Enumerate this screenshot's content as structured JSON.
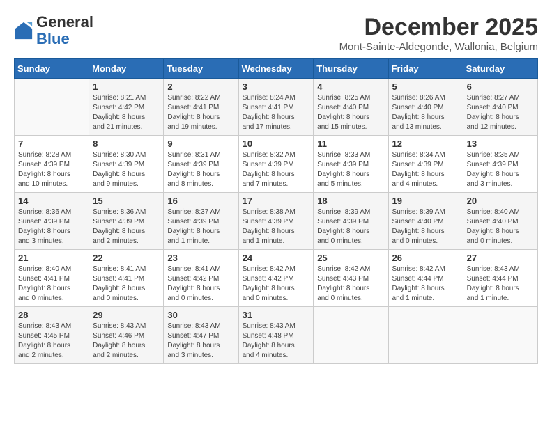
{
  "header": {
    "logo": {
      "line1": "General",
      "line2": "Blue"
    },
    "title": "December 2025",
    "subtitle": "Mont-Sainte-Aldegonde, Wallonia, Belgium"
  },
  "weekdays": [
    "Sunday",
    "Monday",
    "Tuesday",
    "Wednesday",
    "Thursday",
    "Friday",
    "Saturday"
  ],
  "weeks": [
    [
      {
        "day": "",
        "info": ""
      },
      {
        "day": "1",
        "info": "Sunrise: 8:21 AM\nSunset: 4:42 PM\nDaylight: 8 hours\nand 21 minutes."
      },
      {
        "day": "2",
        "info": "Sunrise: 8:22 AM\nSunset: 4:41 PM\nDaylight: 8 hours\nand 19 minutes."
      },
      {
        "day": "3",
        "info": "Sunrise: 8:24 AM\nSunset: 4:41 PM\nDaylight: 8 hours\nand 17 minutes."
      },
      {
        "day": "4",
        "info": "Sunrise: 8:25 AM\nSunset: 4:40 PM\nDaylight: 8 hours\nand 15 minutes."
      },
      {
        "day": "5",
        "info": "Sunrise: 8:26 AM\nSunset: 4:40 PM\nDaylight: 8 hours\nand 13 minutes."
      },
      {
        "day": "6",
        "info": "Sunrise: 8:27 AM\nSunset: 4:40 PM\nDaylight: 8 hours\nand 12 minutes."
      }
    ],
    [
      {
        "day": "7",
        "info": "Sunrise: 8:28 AM\nSunset: 4:39 PM\nDaylight: 8 hours\nand 10 minutes."
      },
      {
        "day": "8",
        "info": "Sunrise: 8:30 AM\nSunset: 4:39 PM\nDaylight: 8 hours\nand 9 minutes."
      },
      {
        "day": "9",
        "info": "Sunrise: 8:31 AM\nSunset: 4:39 PM\nDaylight: 8 hours\nand 8 minutes."
      },
      {
        "day": "10",
        "info": "Sunrise: 8:32 AM\nSunset: 4:39 PM\nDaylight: 8 hours\nand 7 minutes."
      },
      {
        "day": "11",
        "info": "Sunrise: 8:33 AM\nSunset: 4:39 PM\nDaylight: 8 hours\nand 5 minutes."
      },
      {
        "day": "12",
        "info": "Sunrise: 8:34 AM\nSunset: 4:39 PM\nDaylight: 8 hours\nand 4 minutes."
      },
      {
        "day": "13",
        "info": "Sunrise: 8:35 AM\nSunset: 4:39 PM\nDaylight: 8 hours\nand 3 minutes."
      }
    ],
    [
      {
        "day": "14",
        "info": "Sunrise: 8:36 AM\nSunset: 4:39 PM\nDaylight: 8 hours\nand 3 minutes."
      },
      {
        "day": "15",
        "info": "Sunrise: 8:36 AM\nSunset: 4:39 PM\nDaylight: 8 hours\nand 2 minutes."
      },
      {
        "day": "16",
        "info": "Sunrise: 8:37 AM\nSunset: 4:39 PM\nDaylight: 8 hours\nand 1 minute."
      },
      {
        "day": "17",
        "info": "Sunrise: 8:38 AM\nSunset: 4:39 PM\nDaylight: 8 hours\nand 1 minute."
      },
      {
        "day": "18",
        "info": "Sunrise: 8:39 AM\nSunset: 4:39 PM\nDaylight: 8 hours\nand 0 minutes."
      },
      {
        "day": "19",
        "info": "Sunrise: 8:39 AM\nSunset: 4:40 PM\nDaylight: 8 hours\nand 0 minutes."
      },
      {
        "day": "20",
        "info": "Sunrise: 8:40 AM\nSunset: 4:40 PM\nDaylight: 8 hours\nand 0 minutes."
      }
    ],
    [
      {
        "day": "21",
        "info": "Sunrise: 8:40 AM\nSunset: 4:41 PM\nDaylight: 8 hours\nand 0 minutes."
      },
      {
        "day": "22",
        "info": "Sunrise: 8:41 AM\nSunset: 4:41 PM\nDaylight: 8 hours\nand 0 minutes."
      },
      {
        "day": "23",
        "info": "Sunrise: 8:41 AM\nSunset: 4:42 PM\nDaylight: 8 hours\nand 0 minutes."
      },
      {
        "day": "24",
        "info": "Sunrise: 8:42 AM\nSunset: 4:42 PM\nDaylight: 8 hours\nand 0 minutes."
      },
      {
        "day": "25",
        "info": "Sunrise: 8:42 AM\nSunset: 4:43 PM\nDaylight: 8 hours\nand 0 minutes."
      },
      {
        "day": "26",
        "info": "Sunrise: 8:42 AM\nSunset: 4:44 PM\nDaylight: 8 hours\nand 1 minute."
      },
      {
        "day": "27",
        "info": "Sunrise: 8:43 AM\nSunset: 4:44 PM\nDaylight: 8 hours\nand 1 minute."
      }
    ],
    [
      {
        "day": "28",
        "info": "Sunrise: 8:43 AM\nSunset: 4:45 PM\nDaylight: 8 hours\nand 2 minutes."
      },
      {
        "day": "29",
        "info": "Sunrise: 8:43 AM\nSunset: 4:46 PM\nDaylight: 8 hours\nand 2 minutes."
      },
      {
        "day": "30",
        "info": "Sunrise: 8:43 AM\nSunset: 4:47 PM\nDaylight: 8 hours\nand 3 minutes."
      },
      {
        "day": "31",
        "info": "Sunrise: 8:43 AM\nSunset: 4:48 PM\nDaylight: 8 hours\nand 4 minutes."
      },
      {
        "day": "",
        "info": ""
      },
      {
        "day": "",
        "info": ""
      },
      {
        "day": "",
        "info": ""
      }
    ]
  ]
}
